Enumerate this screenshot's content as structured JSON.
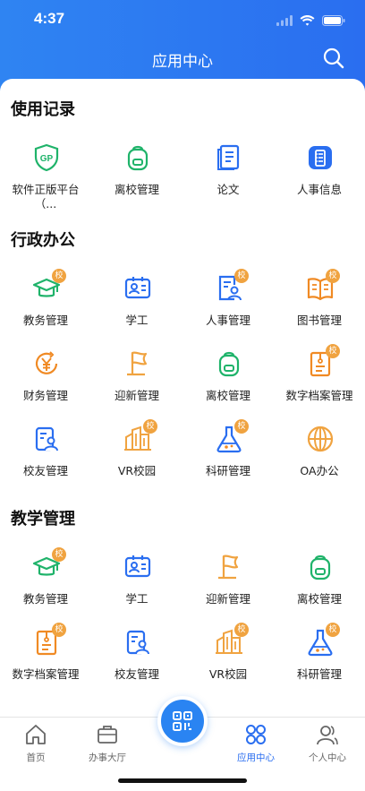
{
  "status": {
    "time": "4:37"
  },
  "header": {
    "title": "应用中心"
  },
  "sections": [
    {
      "title": "使用记录",
      "items": [
        {
          "label": "软件正版平台（...",
          "icon": "gp-shield-icon",
          "badge": ""
        },
        {
          "label": "离校管理",
          "icon": "backpack-icon",
          "badge": ""
        },
        {
          "label": "论文",
          "icon": "paper-icon",
          "badge": ""
        },
        {
          "label": "人事信息",
          "icon": "personnel-info-icon",
          "badge": ""
        }
      ]
    },
    {
      "title": "行政办公",
      "items": [
        {
          "label": "教务管理",
          "icon": "graduation-cap-icon",
          "badge": "校"
        },
        {
          "label": "学工",
          "icon": "student-card-icon",
          "badge": ""
        },
        {
          "label": "人事管理",
          "icon": "person-document-icon",
          "badge": "校"
        },
        {
          "label": "图书管理",
          "icon": "book-icon",
          "badge": "校"
        },
        {
          "label": "财务管理",
          "icon": "yuan-coin-icon",
          "badge": ""
        },
        {
          "label": "迎新管理",
          "icon": "flag-icon",
          "badge": ""
        },
        {
          "label": "离校管理",
          "icon": "backpack-icon",
          "badge": ""
        },
        {
          "label": "数字档案管理",
          "icon": "archive-icon",
          "badge": "校"
        },
        {
          "label": "校友管理",
          "icon": "alumni-icon",
          "badge": ""
        },
        {
          "label": "VR校园",
          "icon": "buildings-icon",
          "badge": "校"
        },
        {
          "label": "科研管理",
          "icon": "flask-icon",
          "badge": "校"
        },
        {
          "label": "OA办公",
          "icon": "globe-icon",
          "badge": ""
        }
      ]
    },
    {
      "title": "教学管理",
      "items": [
        {
          "label": "教务管理",
          "icon": "graduation-cap-icon",
          "badge": "校"
        },
        {
          "label": "学工",
          "icon": "student-card-icon",
          "badge": ""
        },
        {
          "label": "迎新管理",
          "icon": "flag-icon",
          "badge": ""
        },
        {
          "label": "离校管理",
          "icon": "backpack-icon",
          "badge": ""
        },
        {
          "label": "数字档案管理",
          "icon": "archive-icon",
          "badge": "校"
        },
        {
          "label": "校友管理",
          "icon": "alumni-icon",
          "badge": ""
        },
        {
          "label": "VR校园",
          "icon": "buildings-icon",
          "badge": "校"
        },
        {
          "label": "科研管理",
          "icon": "flask-icon",
          "badge": "校"
        }
      ]
    }
  ],
  "tabbar": {
    "tabs": [
      {
        "label": "首页",
        "icon": "home-icon"
      },
      {
        "label": "办事大厅",
        "icon": "briefcase-icon"
      },
      {
        "label": "应用中心",
        "icon": "apps-icon",
        "active": true
      },
      {
        "label": "个人中心",
        "icon": "user-icon"
      }
    ],
    "center_button_icon": "qr-scan-icon"
  },
  "colors": {
    "header": "#2a6ef0",
    "green": "#1fb36a",
    "blue": "#2a6ef0",
    "orange": "#f08a24",
    "badge": "#f0a340"
  }
}
